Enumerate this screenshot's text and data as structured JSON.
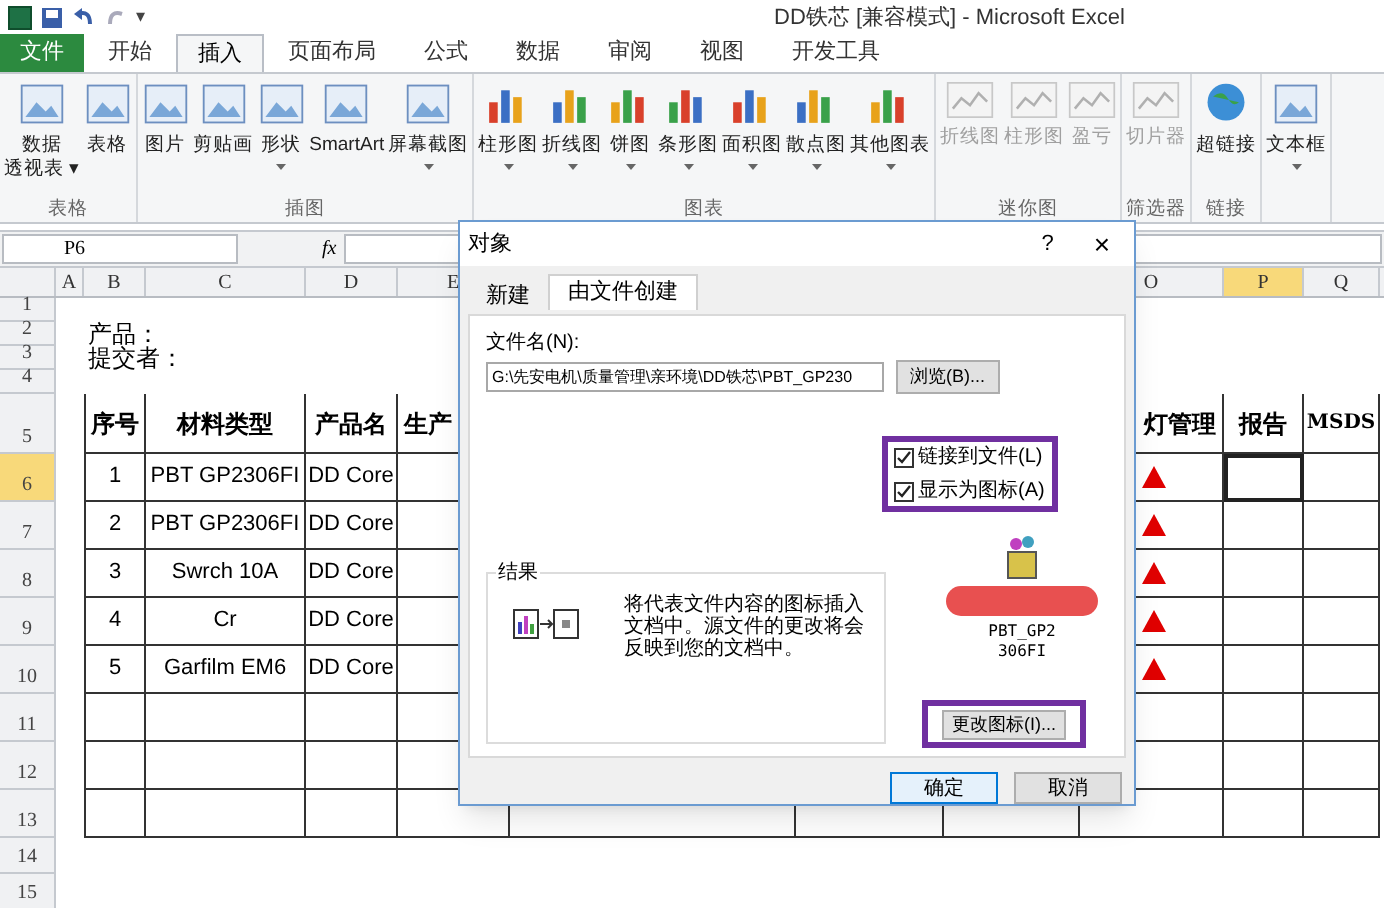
{
  "window": {
    "title": "DD铁芯 [兼容模式] - Microsoft Excel"
  },
  "quick_access": [
    "▾"
  ],
  "tabs": [
    {
      "label": "文件",
      "kind": "file",
      "selected": false
    },
    {
      "label": "开始",
      "kind": "tab",
      "selected": false
    },
    {
      "label": "插入",
      "kind": "tab",
      "selected": true
    },
    {
      "label": "页面布局",
      "kind": "tab",
      "selected": false
    },
    {
      "label": "公式",
      "kind": "tab",
      "selected": false
    },
    {
      "label": "数据",
      "kind": "tab",
      "selected": false
    },
    {
      "label": "审阅",
      "kind": "tab",
      "selected": false
    },
    {
      "label": "视图",
      "kind": "tab",
      "selected": false
    },
    {
      "label": "开发工具",
      "kind": "tab",
      "selected": false
    }
  ],
  "ribbon": [
    {
      "label": "表格",
      "items": [
        {
          "label": "数据",
          "label2": "透视表 ▾",
          "disabled": false
        },
        {
          "label": "表格",
          "disabled": false
        }
      ]
    },
    {
      "label": "插图",
      "items": [
        {
          "label": "图片",
          "disabled": false
        },
        {
          "label": "剪贴画",
          "disabled": false
        },
        {
          "label": "形状",
          "dropdown": true,
          "disabled": false
        },
        {
          "label": "SmartArt",
          "disabled": false
        },
        {
          "label": "屏幕截图",
          "dropdown": true,
          "disabled": false
        }
      ]
    },
    {
      "label": "图表",
      "items": [
        {
          "label": "柱形图",
          "dropdown": true,
          "disabled": false
        },
        {
          "label": "折线图",
          "dropdown": true,
          "disabled": false
        },
        {
          "label": "饼图",
          "dropdown": true,
          "disabled": false
        },
        {
          "label": "条形图",
          "dropdown": true,
          "disabled": false
        },
        {
          "label": "面积图",
          "dropdown": true,
          "disabled": false
        },
        {
          "label": "散点图",
          "dropdown": true,
          "disabled": false
        },
        {
          "label": "其他图表",
          "dropdown": true,
          "disabled": false
        }
      ]
    },
    {
      "label": "迷你图",
      "items": [
        {
          "label": "折线图",
          "disabled": true
        },
        {
          "label": "柱形图",
          "disabled": true
        },
        {
          "label": "盈亏",
          "disabled": true
        }
      ]
    },
    {
      "label": "筛选器",
      "items": [
        {
          "label": "切片器",
          "disabled": true
        }
      ]
    },
    {
      "label": "链接",
      "items": [
        {
          "label": "超链接",
          "disabled": false
        }
      ]
    },
    {
      "items": [
        {
          "label": "文本框",
          "dropdown": true,
          "disabled": false
        }
      ]
    }
  ],
  "formula_bar": {
    "name_box": "P6",
    "fx": "fx"
  },
  "sheet": {
    "columns": [
      {
        "label": "A",
        "selected": false
      },
      {
        "label": "B",
        "selected": false
      },
      {
        "label": "C",
        "selected": false
      },
      {
        "label": "D",
        "selected": false
      },
      {
        "label": "E",
        "selected": false
      },
      {
        "label": "O",
        "selected": false
      },
      {
        "label": "P",
        "selected": true
      },
      {
        "label": "Q",
        "selected": false
      }
    ],
    "rows": [
      {
        "number": "1",
        "kind": "blank",
        "selected": false
      },
      {
        "number": "2",
        "kind": "text",
        "text": "产品：",
        "selected": false
      },
      {
        "number": "3",
        "kind": "text",
        "text": "提交者：",
        "selected": false
      },
      {
        "number": "4",
        "kind": "blank",
        "selected": false
      },
      {
        "number": "5",
        "kind": "header",
        "cells": [
          "序号",
          "材料类型",
          "产品名",
          "生产"
        ],
        "right_cells": [
          "灯管理",
          "报告",
          "MSDS"
        ],
        "selected": false
      },
      {
        "number": "6",
        "kind": "data",
        "cells": [
          "1",
          "PBT GP2306FI",
          "DD Core"
        ],
        "alert": true,
        "selected": true
      },
      {
        "number": "7",
        "kind": "data",
        "cells": [
          "2",
          "PBT GP2306FI",
          "DD Core"
        ],
        "alert": true,
        "selected": false
      },
      {
        "number": "8",
        "kind": "data",
        "cells": [
          "3",
          "Swrch 10A",
          "DD Core"
        ],
        "alert": true,
        "selected": false
      },
      {
        "number": "9",
        "kind": "data",
        "cells": [
          "4",
          "Cr",
          "DD Core"
        ],
        "alert": true,
        "selected": false
      },
      {
        "number": "10",
        "kind": "data",
        "cells": [
          "5",
          "Garfilm EM6",
          "DD Core"
        ],
        "alert": true,
        "selected": false
      },
      {
        "number": "11",
        "kind": "data",
        "cells": [],
        "alert": false,
        "selected": false
      },
      {
        "number": "12",
        "kind": "data",
        "cells": [],
        "alert": false,
        "selected": false
      },
      {
        "number": "13",
        "kind": "data",
        "cells": [],
        "alert": false,
        "selected": false
      },
      {
        "number": "14",
        "kind": "blank",
        "selected": false
      },
      {
        "number": "15",
        "kind": "blank",
        "selected": false
      }
    ]
  },
  "dialog": {
    "title": "对象",
    "help": "?",
    "close": "×",
    "tabs": [
      {
        "label": "新建",
        "selected": false
      },
      {
        "label": "由文件创建",
        "selected": true
      }
    ],
    "file_label": "文件名(N):",
    "file_value": "G:\\先安电机\\质量管理\\亲环境\\DD铁芯\\PBT_GP230",
    "browse": "浏览(B)...",
    "options": [
      {
        "label": "链接到文件(L)",
        "checked": true
      },
      {
        "label": "显示为图标(A)",
        "checked": true
      }
    ],
    "result_label": "结果",
    "result_text": "将代表文件内容的图标插入文档中。源文件的更改将会反映到您的文档中。",
    "icon_caption": [
      "PBT_GP2",
      "306FI"
    ],
    "change_icon": "更改图标(I)...",
    "ok": "确定",
    "cancel": "取消"
  }
}
